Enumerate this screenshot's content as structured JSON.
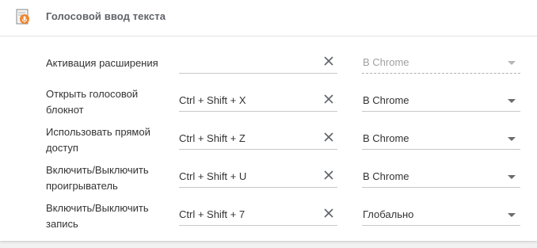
{
  "header": {
    "title": "Голосовой ввод текста",
    "icon": "voice-extension-icon"
  },
  "shortcuts": [
    {
      "label": "Активация расширения",
      "shortcut": "",
      "scope": "В Chrome",
      "scope_disabled": true
    },
    {
      "label": "Открыть голосовой блокнот",
      "shortcut": "Ctrl + Shift + X",
      "scope": "В Chrome",
      "scope_disabled": false
    },
    {
      "label": "Использовать прямой доступ",
      "shortcut": "Ctrl + Shift + Z",
      "scope": "В Chrome",
      "scope_disabled": false
    },
    {
      "label": "Включить/Выключить проигрыватель",
      "shortcut": "Ctrl + Shift + U",
      "scope": "В Chrome",
      "scope_disabled": false
    },
    {
      "label": "Включить/Выключить запись",
      "shortcut": "Ctrl + Shift + 7",
      "scope": "Глобально",
      "scope_disabled": false
    }
  ],
  "colors": {
    "icon_orange": "#f0852d",
    "icon_page": "#f4f4f4",
    "text": "#333333",
    "muted": "#a0a0a0"
  }
}
